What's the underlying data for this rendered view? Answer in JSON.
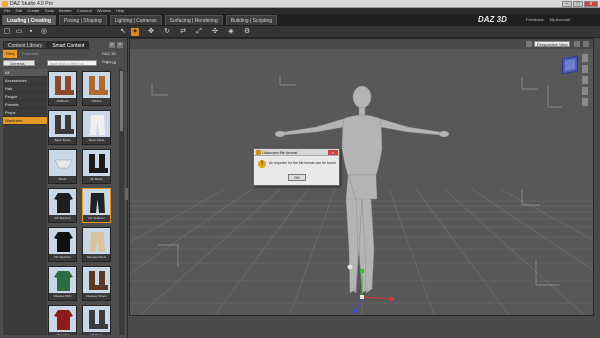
{
  "window": {
    "title": "DAZ Studio 4.0 Pro",
    "buttons": [
      "–",
      "□",
      "x"
    ]
  },
  "menu": [
    "File",
    "Edit",
    "Create",
    "Tools",
    "Render",
    "Connect",
    "Window",
    "Help"
  ],
  "rooms": [
    {
      "label": "Loading | Creating",
      "active": true
    },
    {
      "label": "Posing | Shaping",
      "active": false
    },
    {
      "label": "Lighting | Cameras",
      "active": false
    },
    {
      "label": "Surfacing | Rendering",
      "active": false
    },
    {
      "label": "Building | Scripting",
      "active": false
    }
  ],
  "brand": {
    "logo": "DAZ 3D",
    "links": [
      "Feedback",
      "My Account"
    ]
  },
  "content_panel": {
    "tabs": [
      "Content Library",
      "Smart Content"
    ],
    "subtabs": {
      "files": "Files",
      "products": "Products",
      "store": "DAZ 3D Store"
    },
    "filter_dropdown": "Genesis",
    "search_placeholder": "type text to filter on",
    "count": "1 - 26",
    "categories": [
      {
        "label": "All",
        "type": "all"
      },
      {
        "label": "Accessories",
        "type": "normal"
      },
      {
        "label": "Hair",
        "type": "normal"
      },
      {
        "label": "People",
        "type": "normal"
      },
      {
        "label": "Presets",
        "type": "normal"
      },
      {
        "label": "Props",
        "type": "normal"
      },
      {
        "label": "Wardrobe",
        "type": "selected"
      }
    ],
    "thumbnails": [
      {
        "label": "AMBoots",
        "color": "#8a4a2a",
        "shape": "boot"
      },
      {
        "label": "AMSlut",
        "color": "#b06a2e",
        "shape": "boot"
      },
      {
        "label": "Basic Boots",
        "color": "#3a3a3a",
        "shape": "boot"
      },
      {
        "label": "Basic Pants",
        "color": "#f0f0f0",
        "shape": "pants"
      },
      {
        "label": "Briefs",
        "color": "#e8e8e8",
        "shape": "briefs"
      },
      {
        "label": "DF Boots",
        "color": "#1a1a1a",
        "shape": "boot"
      },
      {
        "label": "DF SkinSuit",
        "color": "#1e1e1e",
        "shape": "suit"
      },
      {
        "label": "DF SuitPant",
        "color": "#222222",
        "shape": "pants"
      },
      {
        "label": "DF TankTop",
        "color": "#111111",
        "shape": "suit"
      },
      {
        "label": "Disease Pants",
        "color": "#d8c39c",
        "shape": "pants"
      },
      {
        "label": "Disease Shirt",
        "color": "#2d6b45",
        "shape": "suit"
      },
      {
        "label": "Disease Shoes",
        "color": "#5a3a24",
        "shape": "boot"
      },
      {
        "label": "HB Jacket",
        "color": "#8e1a1a",
        "shape": "suit"
      },
      {
        "label": "HB Boots",
        "color": "#3b3b3b",
        "shape": "boot"
      }
    ]
  },
  "viewport": {
    "camera_select": "Perspective View"
  },
  "dialog": {
    "title": "Unknown file format",
    "message": "An importer for the file format can be found",
    "ok_label": "OK"
  },
  "colors": {
    "accent": "#e49a27",
    "viewport_bg": "#585858",
    "grid": "#777777"
  }
}
